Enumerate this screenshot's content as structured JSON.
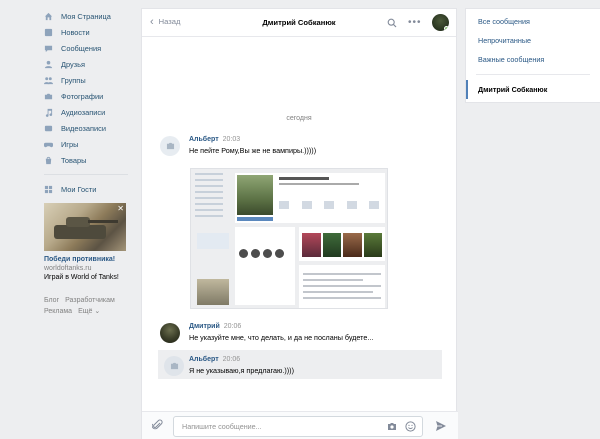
{
  "left_nav": {
    "items": [
      {
        "label": "Моя Страница",
        "icon": "home-icon"
      },
      {
        "label": "Новости",
        "icon": "news-icon"
      },
      {
        "label": "Сообщения",
        "icon": "messages-icon"
      },
      {
        "label": "Друзья",
        "icon": "friends-icon"
      },
      {
        "label": "Группы",
        "icon": "groups-icon"
      },
      {
        "label": "Фотографии",
        "icon": "photos-icon"
      },
      {
        "label": "Аудиозаписи",
        "icon": "audio-icon"
      },
      {
        "label": "Видеозаписи",
        "icon": "video-icon"
      },
      {
        "label": "Игры",
        "icon": "games-icon"
      },
      {
        "label": "Товары",
        "icon": "goods-icon"
      }
    ],
    "apps": [
      {
        "label": "Мои Гости",
        "icon": "apps-grid-icon"
      }
    ],
    "ad": {
      "title": "Победи противника!",
      "domain": "worldoftanks.ru",
      "text": "Играй в World of Tanks!"
    },
    "footer": {
      "blog": "Блог",
      "developers": "Разработчикам",
      "ads": "Реклама",
      "more": "Ещё ⌄"
    }
  },
  "chat": {
    "back_label": "Назад",
    "title": "Дмитрий Собканюк",
    "date_separator": "сегодня",
    "messages": [
      {
        "author": "Альберт",
        "time": "20:03",
        "text": "Не пейте Рому,Вы же не вампиры.)))))"
      },
      {
        "author": "Дмитрий",
        "time": "20:06",
        "text": "Не указуйте мне, что делать, и да не посланы будете..."
      },
      {
        "author": "Альберт",
        "time": "20:06",
        "text": "Я не указываю,я предлагаю.))))"
      }
    ],
    "composer_placeholder": "Напишите сообщение..."
  },
  "right_nav": {
    "items": [
      "Все сообщения",
      "Непрочитанные",
      "Важные сообщения"
    ],
    "active": "Дмитрий Собканюк"
  },
  "colors": {
    "link": "#2a5885",
    "background": "#edeef0",
    "accent": "#5181b8"
  }
}
